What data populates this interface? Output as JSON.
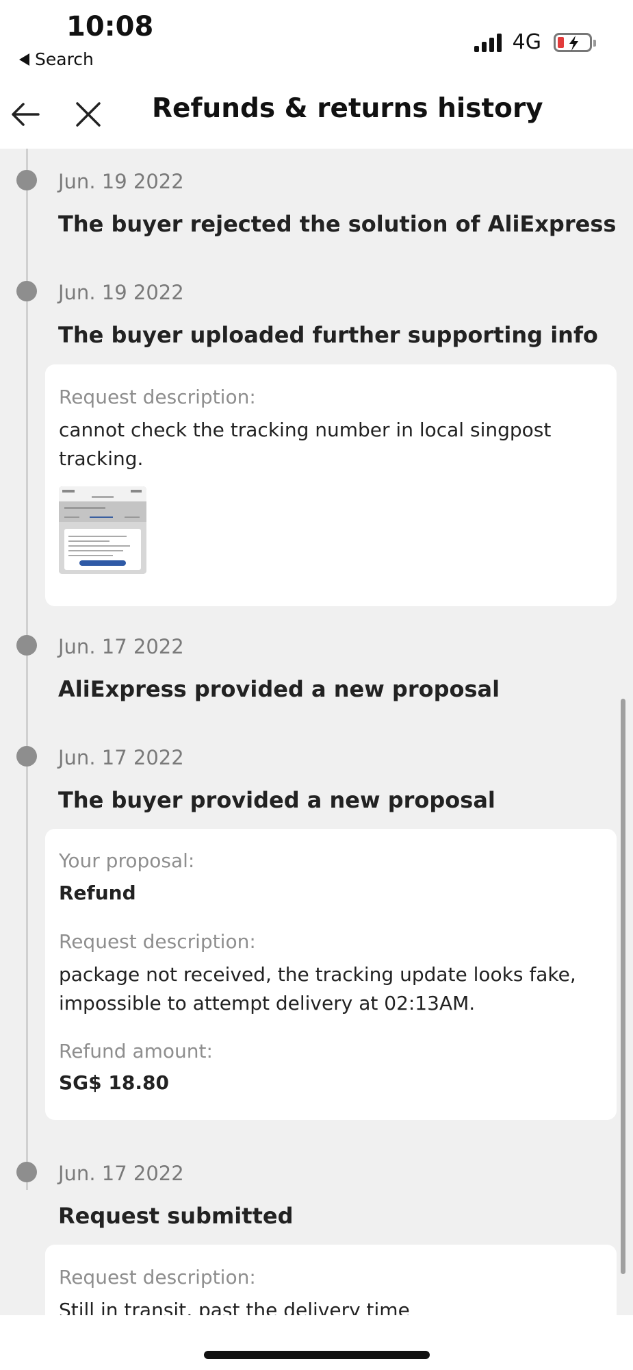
{
  "status_bar": {
    "time": "10:08",
    "back_app_label": "Search",
    "network": "4G",
    "battery_color": "#e23b3b"
  },
  "nav": {
    "title": "Refunds & returns history",
    "back_icon": "arrow-left-icon",
    "close_icon": "close-icon"
  },
  "timeline": [
    {
      "date": "Jun. 19 2022",
      "title": "The buyer rejected the solution of AliExpress"
    },
    {
      "date": "Jun. 19 2022",
      "title": "The buyer uploaded further supporting info",
      "card": {
        "label": "Request description:",
        "text": "cannot check the tracking number in local singpost tracking.",
        "has_image": true
      }
    },
    {
      "date": "Jun. 17 2022",
      "title": "AliExpress provided a new proposal"
    },
    {
      "date": "Jun. 17 2022",
      "title": "The buyer provided a new proposal",
      "card": {
        "proposal_label": "Your proposal:",
        "proposal_value": "Refund",
        "request_label": "Request description:",
        "request_text": "package not received, the tracking update looks fake, impossible to attempt delivery at 02:13AM.",
        "amount_label": "Refund amount:",
        "amount_value": "SG$ 18.80"
      }
    },
    {
      "date": "Jun. 17 2022",
      "title": "Request submitted",
      "card": {
        "label": "Request description:",
        "text": "Still in transit, past the delivery time"
      }
    }
  ]
}
